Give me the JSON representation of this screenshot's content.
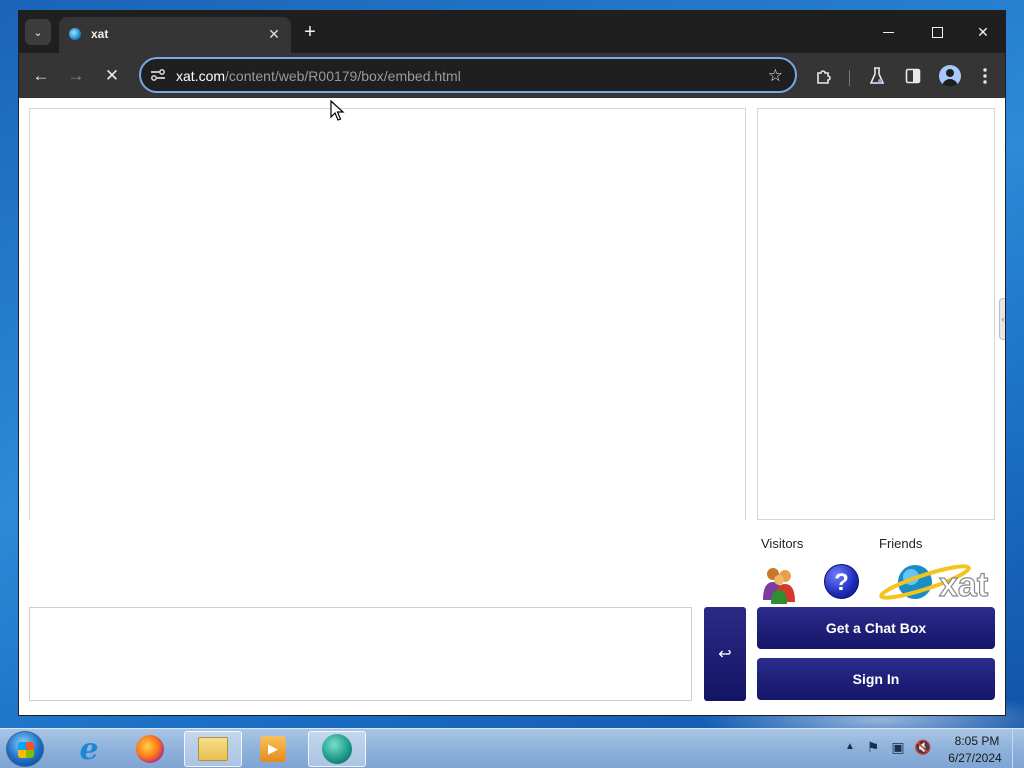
{
  "browser": {
    "tab": {
      "title": "xat",
      "close_glyph": "✕"
    },
    "new_tab_glyph": "+",
    "window_controls": {
      "close_glyph": "✕"
    },
    "nav": {
      "back_glyph": "←",
      "forward_glyph": "→",
      "stop_glyph": "✕"
    },
    "address_bar": {
      "host": "xat.com",
      "path": "/content/web/R00179/box/embed.html"
    },
    "toolbar_icons": [
      "site-info-icon",
      "star-icon",
      "extensions-icon",
      "labs-flask-icon",
      "side-panel-icon",
      "profile-icon",
      "more-menu-icon"
    ]
  },
  "chat": {
    "visitors_label": "Visitors",
    "friends_label": "Friends",
    "send_glyph": "↩",
    "get_chat_box_label": "Get a Chat Box",
    "sign_in_label": "Sign In",
    "logo_text": "xat",
    "help_glyph": "?",
    "accent_color": "#1e1e78"
  },
  "taskbar": {
    "apps": [
      "internet-explorer",
      "firefox",
      "file-explorer",
      "media-player",
      "edge"
    ],
    "active_app": "edge",
    "clock": {
      "time": "8:05 PM",
      "date": "6/27/2024"
    }
  }
}
